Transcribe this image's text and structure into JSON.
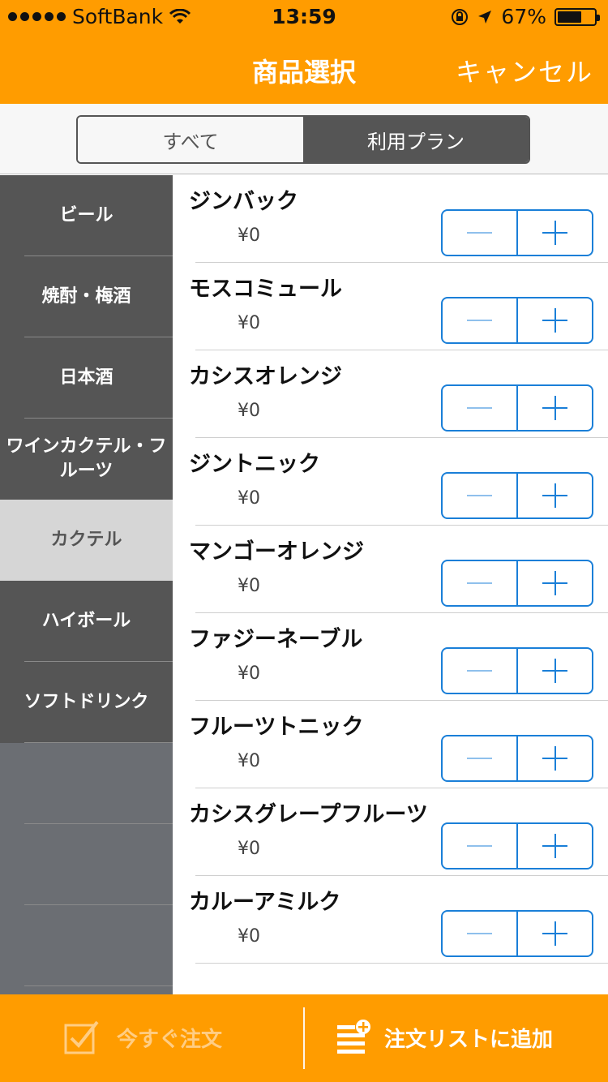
{
  "status_bar": {
    "carrier": "SoftBank",
    "time": "13:59",
    "battery": "67%",
    "battery_level": 0.67
  },
  "nav": {
    "title": "商品選択",
    "cancel_label": "キャンセル"
  },
  "segments": [
    {
      "label": "すべて",
      "selected": false
    },
    {
      "label": "利用プラン",
      "selected": true
    }
  ],
  "categories": [
    {
      "label": "ビール",
      "active": false
    },
    {
      "label": "焼酎・梅酒",
      "active": false
    },
    {
      "label": "日本酒",
      "active": false
    },
    {
      "label": "ワインカクテル・フルーツ",
      "active": false
    },
    {
      "label": "カクテル",
      "active": true
    },
    {
      "label": "ハイボール",
      "active": false
    },
    {
      "label": "ソフトドリンク",
      "active": false
    }
  ],
  "items": [
    {
      "name": "ジンバック",
      "price": "¥0"
    },
    {
      "name": "モスコミュール",
      "price": "¥0"
    },
    {
      "name": "カシスオレンジ",
      "price": "¥0"
    },
    {
      "name": "ジントニック",
      "price": "¥0"
    },
    {
      "name": "マンゴーオレンジ",
      "price": "¥0"
    },
    {
      "name": "ファジーネーブル",
      "price": "¥0"
    },
    {
      "name": "フルーツトニック",
      "price": "¥0"
    },
    {
      "name": "カシスグレープフルーツ",
      "price": "¥0"
    },
    {
      "name": "カルーアミルク",
      "price": "¥0"
    }
  ],
  "toolbar": {
    "order_now_label": "今すぐ注文",
    "add_to_list_label": "注文リストに追加"
  },
  "colors": {
    "accent": "#ff9c00",
    "stepper_blue": "#1a7fd8",
    "sidebar_dark": "#555555"
  }
}
